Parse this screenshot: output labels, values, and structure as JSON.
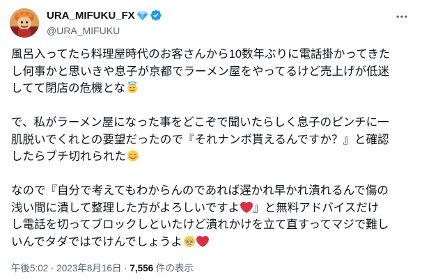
{
  "author": {
    "display_name": "URA_MIFUKU_FX",
    "handle": "@URA_MIFUKU",
    "badges": [
      "diamond-icon",
      "verified-badge-icon"
    ],
    "avatar": "avatar-image"
  },
  "colors": {
    "verified_blue": "#1d9bf0",
    "diamond_blue": "#6ec6ff",
    "text_primary": "#0f1419",
    "text_secondary": "#536471",
    "heart_red": "#e0245e"
  },
  "body": {
    "p1": {
      "l1": "風呂入ってたら料理屋時代のお客さんから10数年ぶりに電話掛かってきた",
      "l2": "し何事かと思いきや息子が京都でラーメン屋をやってるけど売上げが低迷",
      "l3": "してて閉店の危機とな",
      "e1": "smiling-face-with-halo-emoji"
    },
    "p2": {
      "l1": "で、私がラーメン屋になった事をどこぞで聞いたらしく息子のピンチに一",
      "l2": "肌脱いでくれとの要望だったので『それナンボ貰えるんですか？』と確認",
      "l3": "したらブチ切れられた",
      "e1": "smiling-face-with-smiling-eyes-emoji"
    },
    "p3": {
      "l1": "なので『自分で考えてもわからんのであれば遅かれ早かれ潰れるんで傷の",
      "l2a": "浅い間に潰して整理した方がよろしいですよ",
      "l2b": "』と無料アドバイスだけ",
      "l3": "し電話を切ってブロックしといたけど潰れかけを立て直すってマジで難し",
      "l4": "いんでタダではでけんでしょうよ",
      "e_heart": "red-heart-emoji",
      "e_tear": "face-holding-back-tears-emoji"
    }
  },
  "meta": {
    "time": "午後5:02",
    "sep": " · ",
    "date": "2023年8月16日",
    "views_number": "7,556",
    "views_label": " 件の表示"
  },
  "more_button_icon": "more-horizontal-icon"
}
